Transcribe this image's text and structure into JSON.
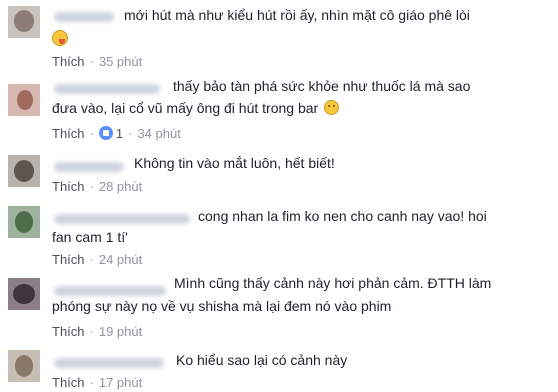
{
  "comments": [
    {
      "lines": [
        "mới hút mà như kiểu hút rồi ấy, nhìn mặt cô giáo phê lòi"
      ],
      "emoji": "tongue-emoji",
      "like_label": "Thích",
      "likes": "",
      "time": "35 phút"
    },
    {
      "lines": [
        "thấy bảo tàn phá sức khỏe như thuốc lá mà sao",
        "đưa vào, lại cổ vũ mấy ông đi hút trong bar"
      ],
      "emoji": "smile-emoji",
      "like_label": "Thích",
      "likes": "1",
      "time": "34 phút"
    },
    {
      "lines": [
        "Không tin vào mắt luôn, hết biết!"
      ],
      "like_label": "Thích",
      "likes": "",
      "time": "28 phút"
    },
    {
      "lines": [
        "cong nhan la fim ko nen cho canh nay vao! hoi",
        "fan cam 1 tí'"
      ],
      "like_label": "Thích",
      "likes": "",
      "time": "24 phút"
    },
    {
      "lines": [
        "Mình cũng thấy cảnh này hơi phản cảm. ĐTTH làm",
        "phóng sự này nọ về vụ shisha mà lại đem nó vào phim"
      ],
      "like_label": "Thích",
      "likes": "",
      "time": "19 phút"
    },
    {
      "lines": [
        "Ko hiểu sao lại có cảnh này"
      ],
      "like_label": "Thích",
      "likes": "",
      "time": "17 phút"
    }
  ],
  "separator": "·",
  "colors": {
    "text": "#1d2129",
    "meta": "#90949c",
    "like_blue": "#5890ff"
  }
}
